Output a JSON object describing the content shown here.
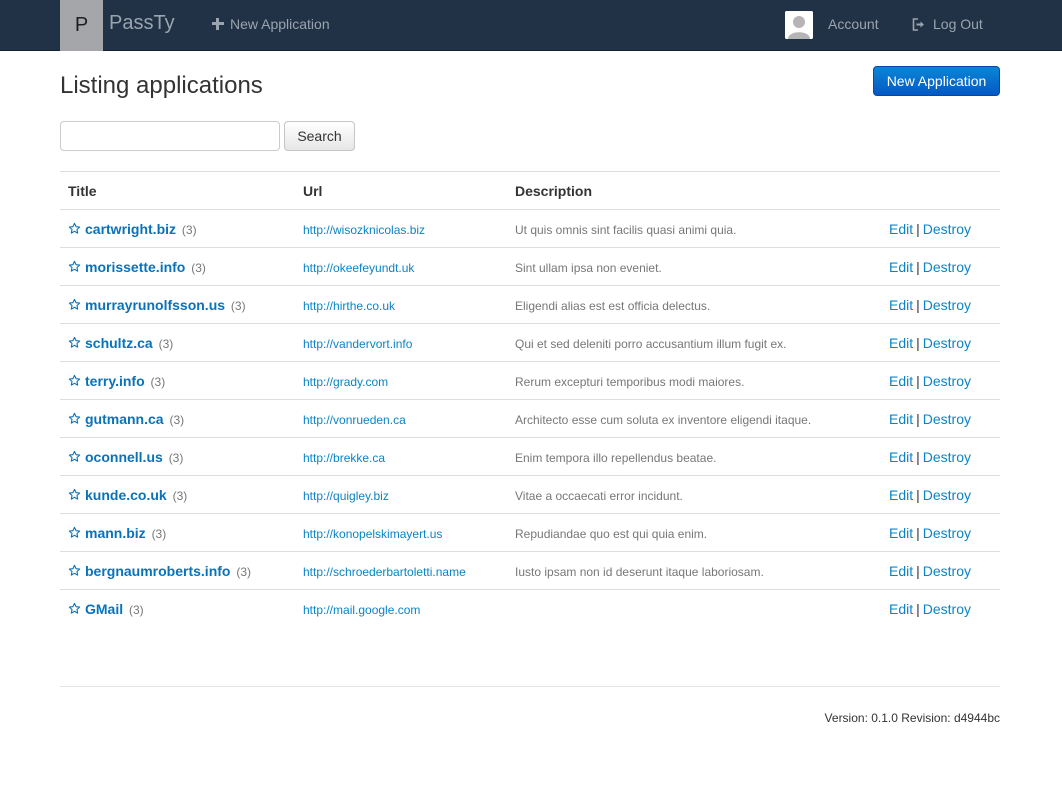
{
  "navbar": {
    "brand_letter": "P",
    "brand_name": "PassTy",
    "new_application": "New Application",
    "account": "Account",
    "logout": "Log Out",
    "background_color": "#223246"
  },
  "page": {
    "title": "Listing applications",
    "new_button": "New Application",
    "search_button": "Search",
    "search_value": "",
    "accent_color": "#0a84c6"
  },
  "table": {
    "headers": [
      "Title",
      "Url",
      "Description",
      ""
    ],
    "edit_label": "Edit",
    "destroy_label": "Destroy",
    "separator": "|",
    "rows": [
      {
        "title": "cartwright.biz",
        "count": "(3)",
        "url": "http://wisozknicolas.biz",
        "description": "Ut quis omnis sint facilis quasi animi quia."
      },
      {
        "title": "morissette.info",
        "count": "(3)",
        "url": "http://okeefeyundt.uk",
        "description": "Sint ullam ipsa non eveniet."
      },
      {
        "title": "murrayrunolfsson.us",
        "count": "(3)",
        "url": "http://hirthe.co.uk",
        "description": "Eligendi alias est est officia delectus."
      },
      {
        "title": "schultz.ca",
        "count": "(3)",
        "url": "http://vandervort.info",
        "description": "Qui et sed deleniti porro accusantium illum fugit ex."
      },
      {
        "title": "terry.info",
        "count": "(3)",
        "url": "http://grady.com",
        "description": "Rerum excepturi temporibus modi maiores."
      },
      {
        "title": "gutmann.ca",
        "count": "(3)",
        "url": "http://vonrueden.ca",
        "description": "Architecto esse cum soluta ex inventore eligendi itaque."
      },
      {
        "title": "oconnell.us",
        "count": "(3)",
        "url": "http://brekke.ca",
        "description": "Enim tempora illo repellendus beatae."
      },
      {
        "title": "kunde.co.uk",
        "count": "(3)",
        "url": "http://quigley.biz",
        "description": "Vitae a occaecati error incidunt."
      },
      {
        "title": "mann.biz",
        "count": "(3)",
        "url": "http://konopelskimayert.us",
        "description": "Repudiandae quo est qui quia enim."
      },
      {
        "title": "bergnaumroberts.info",
        "count": "(3)",
        "url": "http://schroederbartoletti.name",
        "description": "Iusto ipsam non id deserunt itaque laboriosam."
      },
      {
        "title": "GMail",
        "count": "(3)",
        "url": "http://mail.google.com",
        "description": ""
      }
    ]
  },
  "footer": {
    "version": "Version: 0.1.0 Revision: d4944bc"
  }
}
